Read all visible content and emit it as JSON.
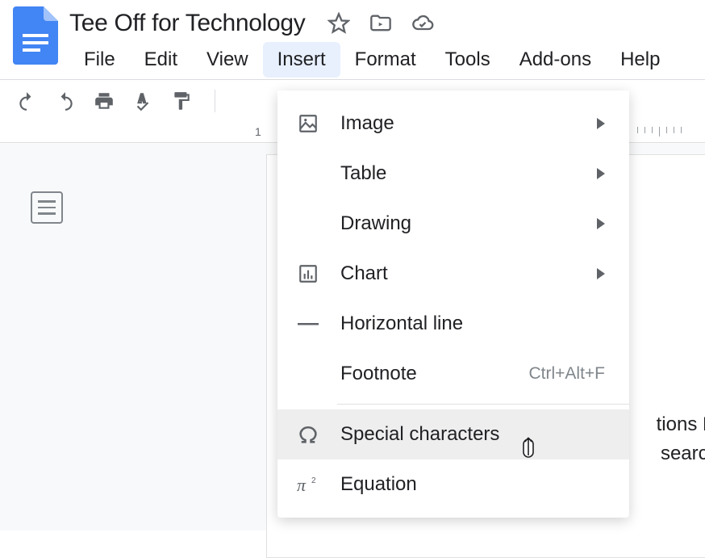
{
  "doc": {
    "title": "Tee Off for Technology"
  },
  "menubar": {
    "file": "File",
    "edit": "Edit",
    "view": "View",
    "insert": "Insert",
    "format": "Format",
    "tools": "Tools",
    "addons": "Add-ons",
    "help": "Help"
  },
  "ruler": {
    "one": "1"
  },
  "dropdown": {
    "image": "Image",
    "table": "Table",
    "drawing": "Drawing",
    "chart": "Chart",
    "horizontal_line": "Horizontal line",
    "footnote": {
      "label": "Footnote",
      "shortcut": "Ctrl+Alt+F"
    },
    "special_characters": "Special characters",
    "equation": "Equation"
  },
  "page_fragments": {
    "f1": "tions M",
    "f2": "search"
  }
}
